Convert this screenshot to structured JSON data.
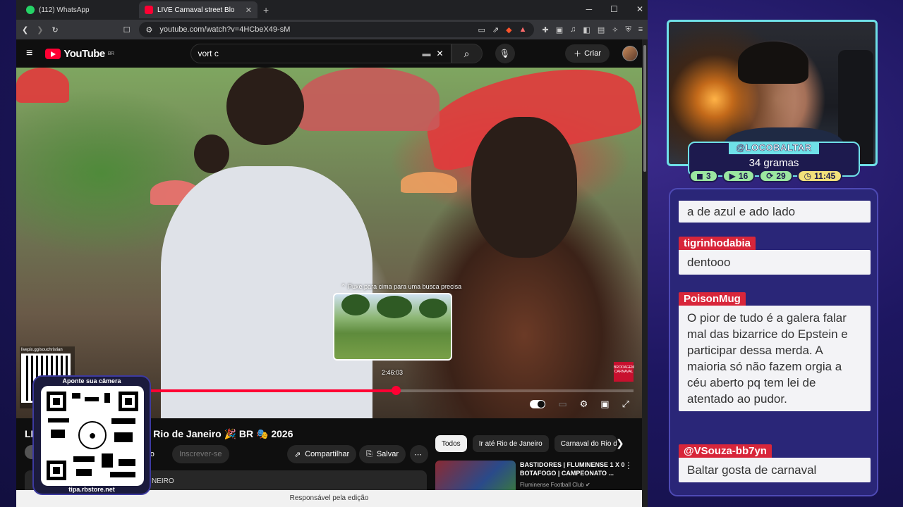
{
  "browser": {
    "tabs": [
      {
        "label": "(112) WhatsApp",
        "color": "#25d366",
        "active": false
      },
      {
        "label": "LIVE Carnaval street Block in Rio de",
        "color": "#ff0033",
        "active": true
      }
    ],
    "new_tab": "+",
    "window_controls": {
      "minimize": "─",
      "maximize": "☐",
      "close": "✕"
    },
    "url": "youtube.com/watch?v=4HCbeX49-sM"
  },
  "youtube": {
    "logo_text": "YouTube",
    "region": "BR",
    "search_query": "vort c",
    "create_label": "Criar",
    "video": {
      "preview_hint": "Puxe para cima para uma busca precisa",
      "preview_time": "2:46:03",
      "progress_fraction": 0.61,
      "brand_badge": "BRODAGEM CARNAVAL"
    },
    "title_left": "LI",
    "title_right": "Rio de Janeiro 🎉 BR 🎭 2026",
    "subscribe_partial": "bro",
    "subscribe_label": "Inscrever-se",
    "share_label": "Compartilhar",
    "save_label": "Salvar",
    "desc_partial": "NEIRO",
    "chips": [
      "Todos",
      "Ir até Rio de Janeiro",
      "Carnaval do Rio d"
    ],
    "recommended": {
      "title": "BASTIDORES | FLUMINENSE 1 X 0 BOTAFOGO | CAMPEONATO ...",
      "channel": "Fluminense Football Club"
    },
    "toast": "Responsável pela edição"
  },
  "overlay": {
    "livepix": "livepix.gg/souchristian",
    "qr_top": "Aponte sua câmera",
    "qr_bottom": "tipa.rbstore.net"
  },
  "streamer": {
    "name": "@LOCOBALTAR",
    "subtitle": "34 gramas",
    "badges": [
      {
        "icon": "twitch-icon",
        "value": "3",
        "color": "#9be6a0"
      },
      {
        "icon": "youtube-icon",
        "value": "16",
        "color": "#9be6a0"
      },
      {
        "icon": "kick-icon",
        "value": "29",
        "color": "#9be6a0"
      },
      {
        "icon": "clock-icon",
        "value": "11:45",
        "color": "#f3e07a"
      }
    ]
  },
  "chat": [
    {
      "user": "",
      "text": "a de azul e ado lado"
    },
    {
      "user": "tigrinhodabia",
      "user_color": "#d8263a",
      "text": "dentooo"
    },
    {
      "user": "PoisonMug",
      "user_color": "#d8263a",
      "text": "O pior de tudo é a galera falar mal das bizarrice do Epstein e participar dessa merda. A maioria só não fazem orgia a céu aberto pq tem lei de atentado ao pudor."
    },
    {
      "user": "@VSouza-bb7yn",
      "user_color": "#d8263a",
      "text": "Baltar gosta de carnaval"
    }
  ]
}
